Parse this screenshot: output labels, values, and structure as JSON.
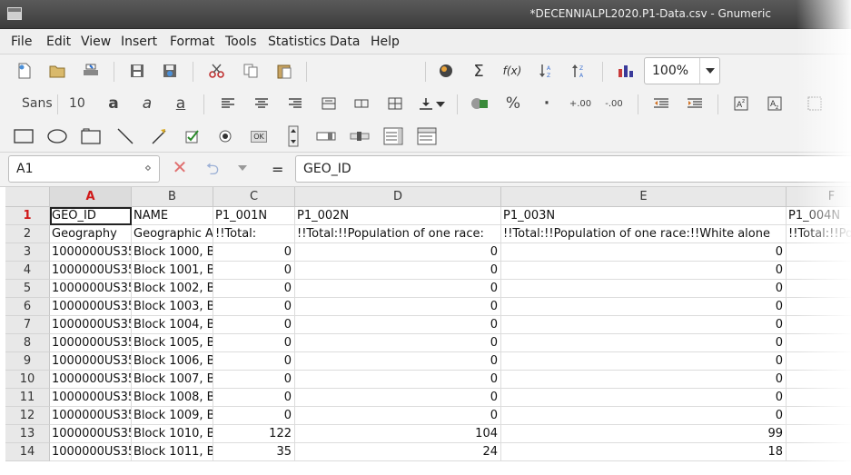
{
  "window": {
    "title": "*DECENNIALPL2020.P1-Data.csv - Gnumeric"
  },
  "menu": [
    "File",
    "Edit",
    "View",
    "Insert",
    "Format",
    "Tools",
    "Statistics",
    "Data",
    "Help"
  ],
  "toolbar": {
    "zoom": "100%",
    "font_name": "Sans",
    "font_size": "10",
    "checkbox_button_label": "OK"
  },
  "editline": {
    "cell_ref": "A1",
    "formula": "GEO_ID",
    "equals": "="
  },
  "grid": {
    "columns": [
      "A",
      "B",
      "C",
      "D",
      "E",
      "F"
    ],
    "rows": [
      {
        "n": "1",
        "cells": [
          "GEO_ID",
          "NAME",
          "P1_001N",
          "P1_002N",
          "P1_003N",
          "P1_004N"
        ]
      },
      {
        "n": "2",
        "cells": [
          "Geography",
          "Geographic Area Name",
          "!!Total:",
          "!!Total:!!Population of one race:",
          "!!Total:!!Population of one race:!!White alone",
          "!!Total:!!Population"
        ]
      },
      {
        "n": "3",
        "cells": [
          "1000000US35",
          "Block 1000, B",
          "0",
          "0",
          "0",
          ""
        ]
      },
      {
        "n": "4",
        "cells": [
          "1000000US35",
          "Block 1001, B",
          "0",
          "0",
          "0",
          ""
        ]
      },
      {
        "n": "5",
        "cells": [
          "1000000US35",
          "Block 1002, B",
          "0",
          "0",
          "0",
          ""
        ]
      },
      {
        "n": "6",
        "cells": [
          "1000000US35",
          "Block 1003, B",
          "0",
          "0",
          "0",
          ""
        ]
      },
      {
        "n": "7",
        "cells": [
          "1000000US35",
          "Block 1004, B",
          "0",
          "0",
          "0",
          ""
        ]
      },
      {
        "n": "8",
        "cells": [
          "1000000US35",
          "Block 1005, B",
          "0",
          "0",
          "0",
          ""
        ]
      },
      {
        "n": "9",
        "cells": [
          "1000000US35",
          "Block 1006, B",
          "0",
          "0",
          "0",
          ""
        ]
      },
      {
        "n": "10",
        "cells": [
          "1000000US35",
          "Block 1007, B",
          "0",
          "0",
          "0",
          ""
        ]
      },
      {
        "n": "11",
        "cells": [
          "1000000US35",
          "Block 1008, B",
          "0",
          "0",
          "0",
          ""
        ]
      },
      {
        "n": "12",
        "cells": [
          "1000000US35",
          "Block 1009, B",
          "0",
          "0",
          "0",
          ""
        ]
      },
      {
        "n": "13",
        "cells": [
          "1000000US35",
          "Block 1010, B",
          "122",
          "104",
          "99",
          ""
        ]
      },
      {
        "n": "14",
        "cells": [
          "1000000US35",
          "Block 1011, B",
          "35",
          "24",
          "18",
          ""
        ]
      }
    ]
  }
}
